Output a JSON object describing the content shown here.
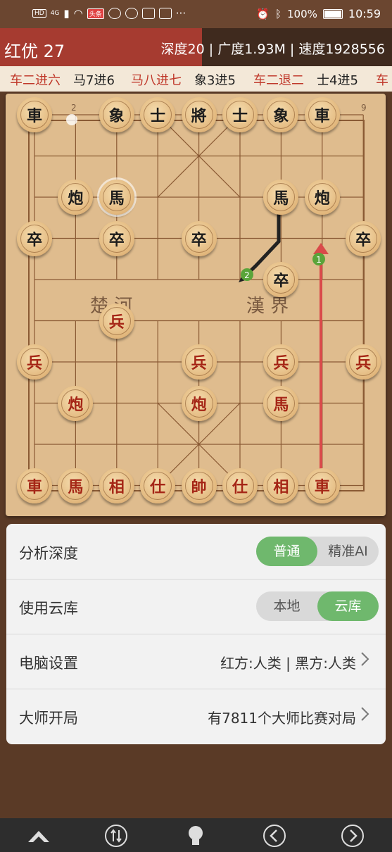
{
  "status_bar": {
    "left": [
      "HD",
      "4G",
      "头条"
    ],
    "battery": "100%",
    "time": "10:59"
  },
  "eval": {
    "title": "红优 27",
    "stats": "深度20 | 广度1.93M | 速度1928556"
  },
  "moves": [
    {
      "text": "车二进六",
      "side": "red"
    },
    {
      "text": "马7进6",
      "side": "black"
    },
    {
      "text": "马八进七",
      "side": "red"
    },
    {
      "text": "象3进5",
      "side": "black"
    },
    {
      "text": "车二退二",
      "side": "red"
    },
    {
      "text": "士4进5",
      "side": "black"
    },
    {
      "text": "车",
      "side": "red"
    }
  ],
  "board": {
    "river_left": "楚 河",
    "river_right": "漢 界",
    "file_label_left": "2",
    "file_label_right": "9",
    "arrow_labels": [
      "1",
      "2"
    ],
    "pieces": [
      {
        "ch": "車",
        "side": "black",
        "col": 0,
        "row": 0
      },
      {
        "ch": "象",
        "side": "black",
        "col": 2,
        "row": 0
      },
      {
        "ch": "士",
        "side": "black",
        "col": 3,
        "row": 0
      },
      {
        "ch": "將",
        "side": "black",
        "col": 4,
        "row": 0
      },
      {
        "ch": "士",
        "side": "black",
        "col": 5,
        "row": 0
      },
      {
        "ch": "象",
        "side": "black",
        "col": 6,
        "row": 0
      },
      {
        "ch": "車",
        "side": "black",
        "col": 7,
        "row": 0
      },
      {
        "ch": "炮",
        "side": "black",
        "col": 1,
        "row": 2
      },
      {
        "ch": "馬",
        "side": "black",
        "col": 2,
        "row": 2,
        "selected": true
      },
      {
        "ch": "馬",
        "side": "black",
        "col": 6,
        "row": 2
      },
      {
        "ch": "炮",
        "side": "black",
        "col": 7,
        "row": 2
      },
      {
        "ch": "卒",
        "side": "black",
        "col": 0,
        "row": 3
      },
      {
        "ch": "卒",
        "side": "black",
        "col": 2,
        "row": 3
      },
      {
        "ch": "卒",
        "side": "black",
        "col": 4,
        "row": 3
      },
      {
        "ch": "卒",
        "side": "black",
        "col": 8,
        "row": 3
      },
      {
        "ch": "卒",
        "side": "black",
        "col": 6,
        "row": 4
      },
      {
        "ch": "兵",
        "side": "red",
        "col": 2,
        "row": 5
      },
      {
        "ch": "兵",
        "side": "red",
        "col": 0,
        "row": 6
      },
      {
        "ch": "兵",
        "side": "red",
        "col": 4,
        "row": 6
      },
      {
        "ch": "兵",
        "side": "red",
        "col": 6,
        "row": 6
      },
      {
        "ch": "兵",
        "side": "red",
        "col": 8,
        "row": 6
      },
      {
        "ch": "炮",
        "side": "red",
        "col": 1,
        "row": 7
      },
      {
        "ch": "炮",
        "side": "red",
        "col": 4,
        "row": 7
      },
      {
        "ch": "馬",
        "side": "red",
        "col": 6,
        "row": 7
      },
      {
        "ch": "車",
        "side": "red",
        "col": 0,
        "row": 9
      },
      {
        "ch": "馬",
        "side": "red",
        "col": 1,
        "row": 9
      },
      {
        "ch": "相",
        "side": "red",
        "col": 2,
        "row": 9
      },
      {
        "ch": "仕",
        "side": "red",
        "col": 3,
        "row": 9
      },
      {
        "ch": "帥",
        "side": "red",
        "col": 4,
        "row": 9
      },
      {
        "ch": "仕",
        "side": "red",
        "col": 5,
        "row": 9
      },
      {
        "ch": "相",
        "side": "red",
        "col": 6,
        "row": 9
      },
      {
        "ch": "車",
        "side": "red",
        "col": 7,
        "row": 9
      }
    ]
  },
  "settings": {
    "depth": {
      "label": "分析深度",
      "opt1": "普通",
      "opt2": "精准AI",
      "active": 1
    },
    "cloud": {
      "label": "使用云库",
      "opt1": "本地",
      "opt2": "云库",
      "active": 2
    },
    "computer": {
      "label": "电脑设置",
      "value": "红方:人类 | 黑方:人类"
    },
    "master": {
      "label": "大师开局",
      "value": "有7811个大师比赛对局"
    }
  },
  "colors": {
    "red_eval": "#a63b30",
    "accent_green": "#6fb86d",
    "red_text": "#c0392b"
  },
  "nav_icons": [
    "mountain-icon",
    "flip-icon",
    "hint-bulb-icon",
    "back-icon",
    "forward-icon"
  ]
}
